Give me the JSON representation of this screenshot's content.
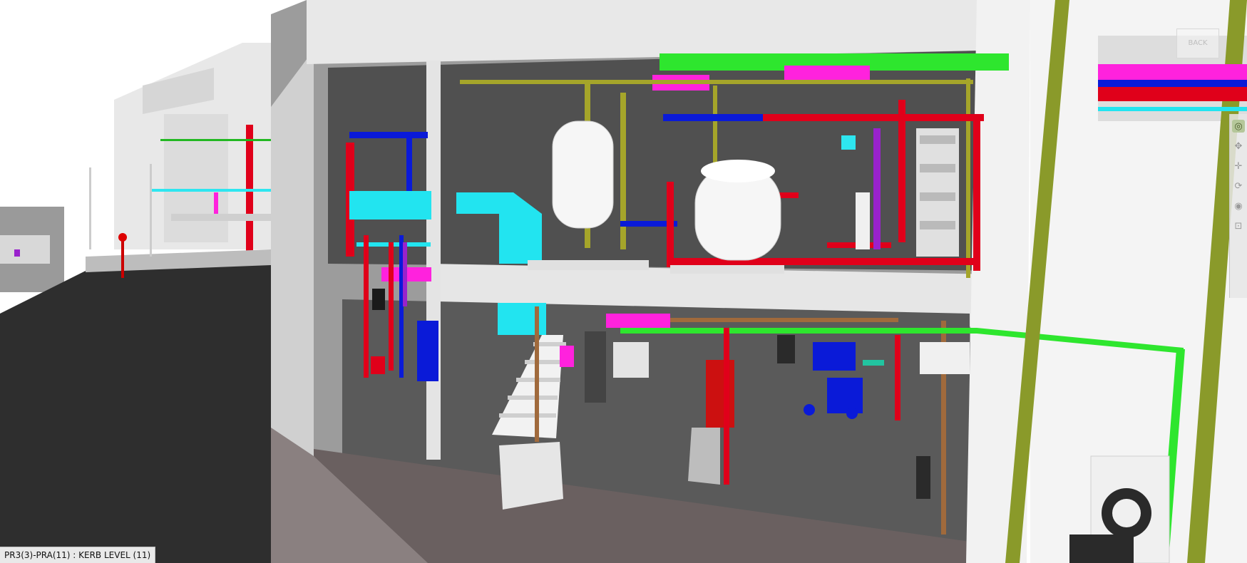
{
  "viewport": {
    "status_label": "PR3(3)-PRA(11) : KERB LEVEL (11)"
  },
  "viewcube": {
    "label": "BACK"
  },
  "nav_bar": {
    "items": [
      {
        "icon": "steering-wheel-icon",
        "glyph": "◎"
      },
      {
        "icon": "pan-icon",
        "glyph": "✥"
      },
      {
        "icon": "zoom-icon",
        "glyph": "✛"
      },
      {
        "icon": "orbit-icon",
        "glyph": "⟳"
      },
      {
        "icon": "look-icon",
        "glyph": "◉"
      },
      {
        "icon": "extents-icon",
        "glyph": "⊡"
      }
    ]
  },
  "colors": {
    "sky": "#ffffff",
    "road": "#2e2e2e",
    "floor": "#555555",
    "wall": "#e6e6e6",
    "fire_pipe": "#e0001a",
    "water_pipe": "#0a1ad8",
    "duct_cyan": "#22e4f0",
    "duct_magenta": "#ff22dd",
    "green_pipe": "#2ee62e",
    "olive_pipe": "#9aa62a",
    "brown_pipe": "#a06a3c"
  }
}
